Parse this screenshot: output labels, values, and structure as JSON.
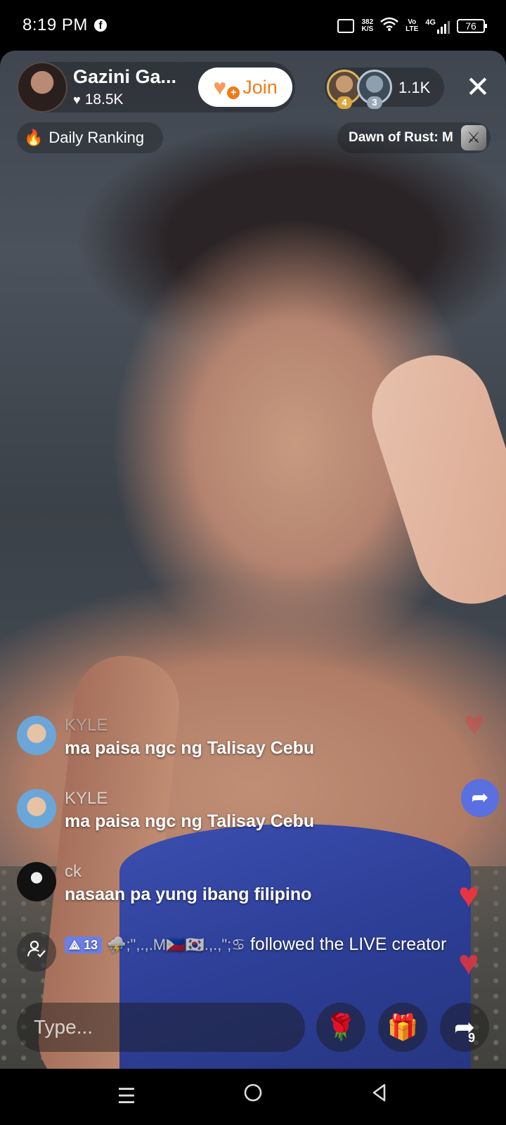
{
  "status_bar": {
    "time": "8:19 PM",
    "fb_icon": "f",
    "speed_value": "382",
    "speed_unit": "K/S",
    "volte_top": "Vo",
    "volte_bottom": "LTE",
    "network": "4G",
    "battery": "76"
  },
  "host": {
    "name": "Gazini Ga...",
    "likes": "18.5K",
    "join_label": "Join"
  },
  "viewers": {
    "rank_1": "4",
    "rank_2": "3",
    "count": "1.1K"
  },
  "ranking": {
    "label": "Daily Ranking"
  },
  "game": {
    "label": "Dawn of Rust: M"
  },
  "chat": [
    {
      "user": "KYLE",
      "message": "ma paisa ngc ng Talisay Cebu"
    },
    {
      "user": "KYLE",
      "message": "ma paisa ngc ng Talisay Cebu"
    },
    {
      "user": "ck",
      "message": "nasaan pa yung ibang filipino"
    }
  ],
  "follow_event": {
    "level": "13",
    "name": "⛈️;\",.,.M🇵🇭🇰🇷.,.,\";♋",
    "action": "followed the LIVE creator"
  },
  "input": {
    "placeholder": "Type..."
  },
  "share": {
    "count": "9"
  },
  "colors": {
    "join_text": "#f27d1b",
    "heart_red": "#e8343f",
    "share_blue": "#5a6fe0",
    "level_badge": "#6b7ee8"
  }
}
